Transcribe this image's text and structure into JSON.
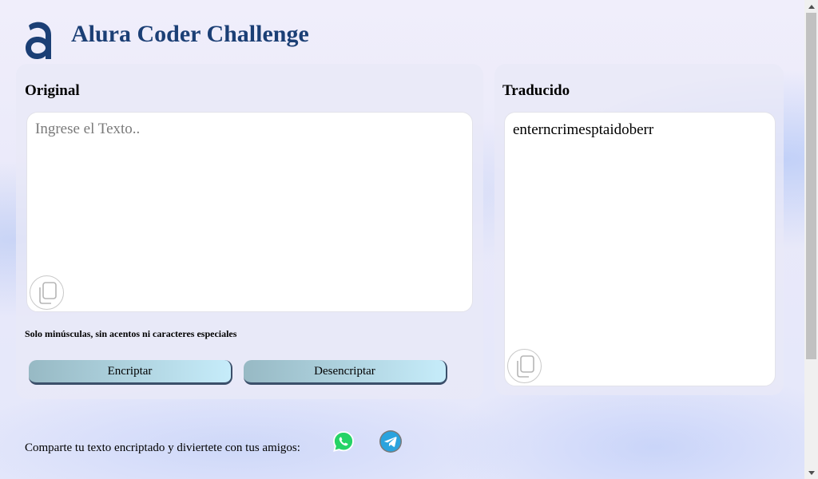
{
  "header": {
    "title": "Alura Coder Challenge",
    "logo_icon": "alura-logo-icon"
  },
  "original": {
    "title": "Original",
    "placeholder": "Ingrese el Texto..",
    "value": "",
    "copy_icon": "copy-icon"
  },
  "translated": {
    "title": "Traducido",
    "value": "enterncrimesptaidoberr",
    "copy_icon": "copy-icon"
  },
  "hint": "Solo minúsculas, sin acentos ni caracteres especiales",
  "buttons": {
    "encrypt_label": "Encriptar",
    "decrypt_label": "Desencriptar"
  },
  "share": {
    "text": "Comparte tu texto encriptado y diviertete con tus amigos:",
    "whatsapp_icon": "whatsapp-icon",
    "telegram_icon": "telegram-icon"
  },
  "colors": {
    "title": "#1b3f75",
    "button_gradient_start": "#97b9c4",
    "button_gradient_end": "#c6ecfa",
    "whatsapp": "#25d366",
    "telegram": "#2aa3de"
  }
}
